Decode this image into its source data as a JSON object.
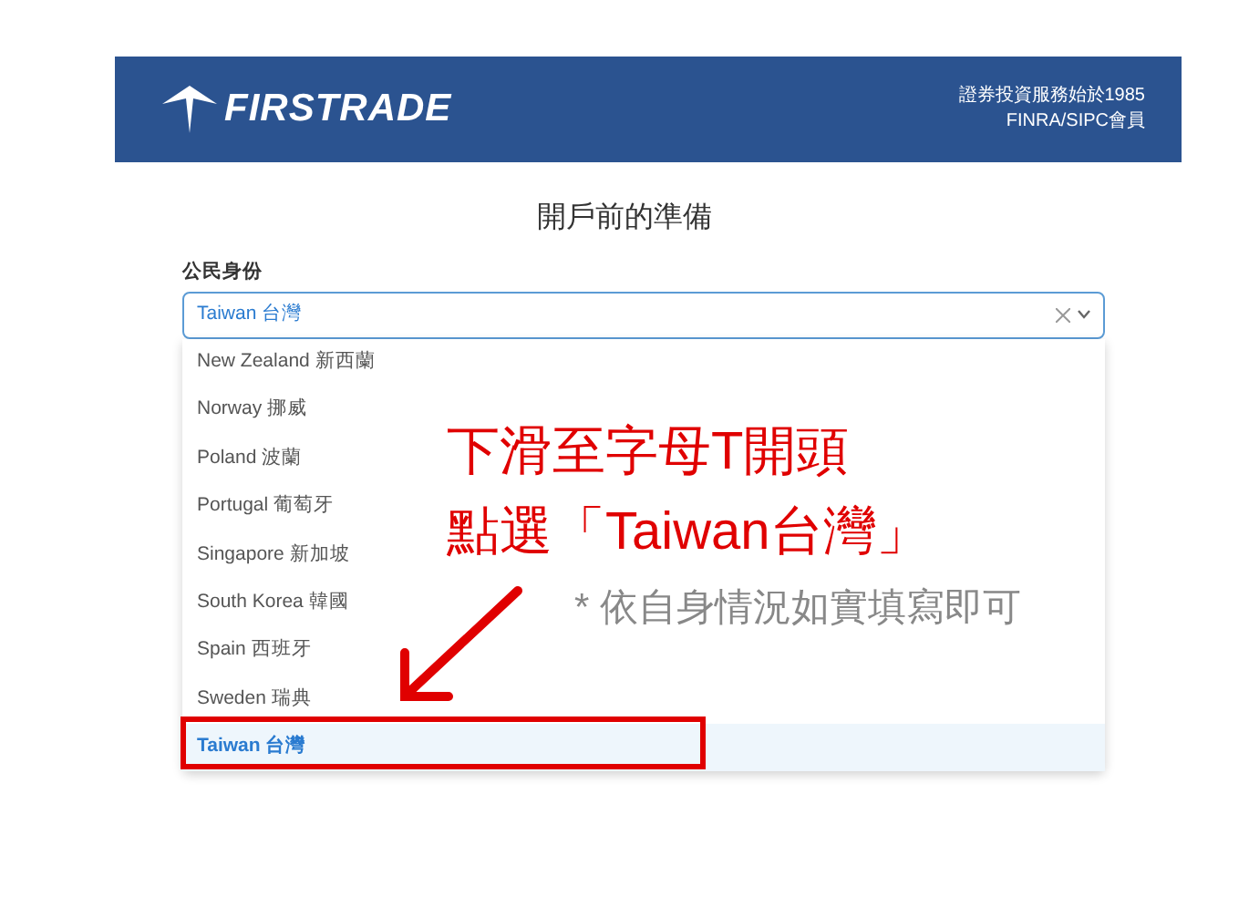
{
  "header": {
    "brand": "FIRSTRADE",
    "tagline": [
      "證券投資服務始於1985",
      "FINRA/SIPC會員"
    ]
  },
  "page_title": "開戶前的準備",
  "field": {
    "label": "公民身份",
    "value": "Taiwan 台灣"
  },
  "options": [
    {
      "label": "New Zealand 新西蘭",
      "selected": false
    },
    {
      "label": "Norway 挪威",
      "selected": false
    },
    {
      "label": "Poland 波蘭",
      "selected": false
    },
    {
      "label": "Portugal 葡萄牙",
      "selected": false
    },
    {
      "label": "Singapore 新加坡",
      "selected": false
    },
    {
      "label": "South Korea 韓國",
      "selected": false
    },
    {
      "label": "Spain 西班牙",
      "selected": false
    },
    {
      "label": "Sweden 瑞典",
      "selected": false
    },
    {
      "label": "Taiwan 台灣",
      "selected": true
    }
  ],
  "annotation": {
    "instruction": [
      "下滑至字母T開頭",
      "點選「Taiwan台灣」"
    ],
    "note": "* 依自身情況如實填寫即可"
  }
}
